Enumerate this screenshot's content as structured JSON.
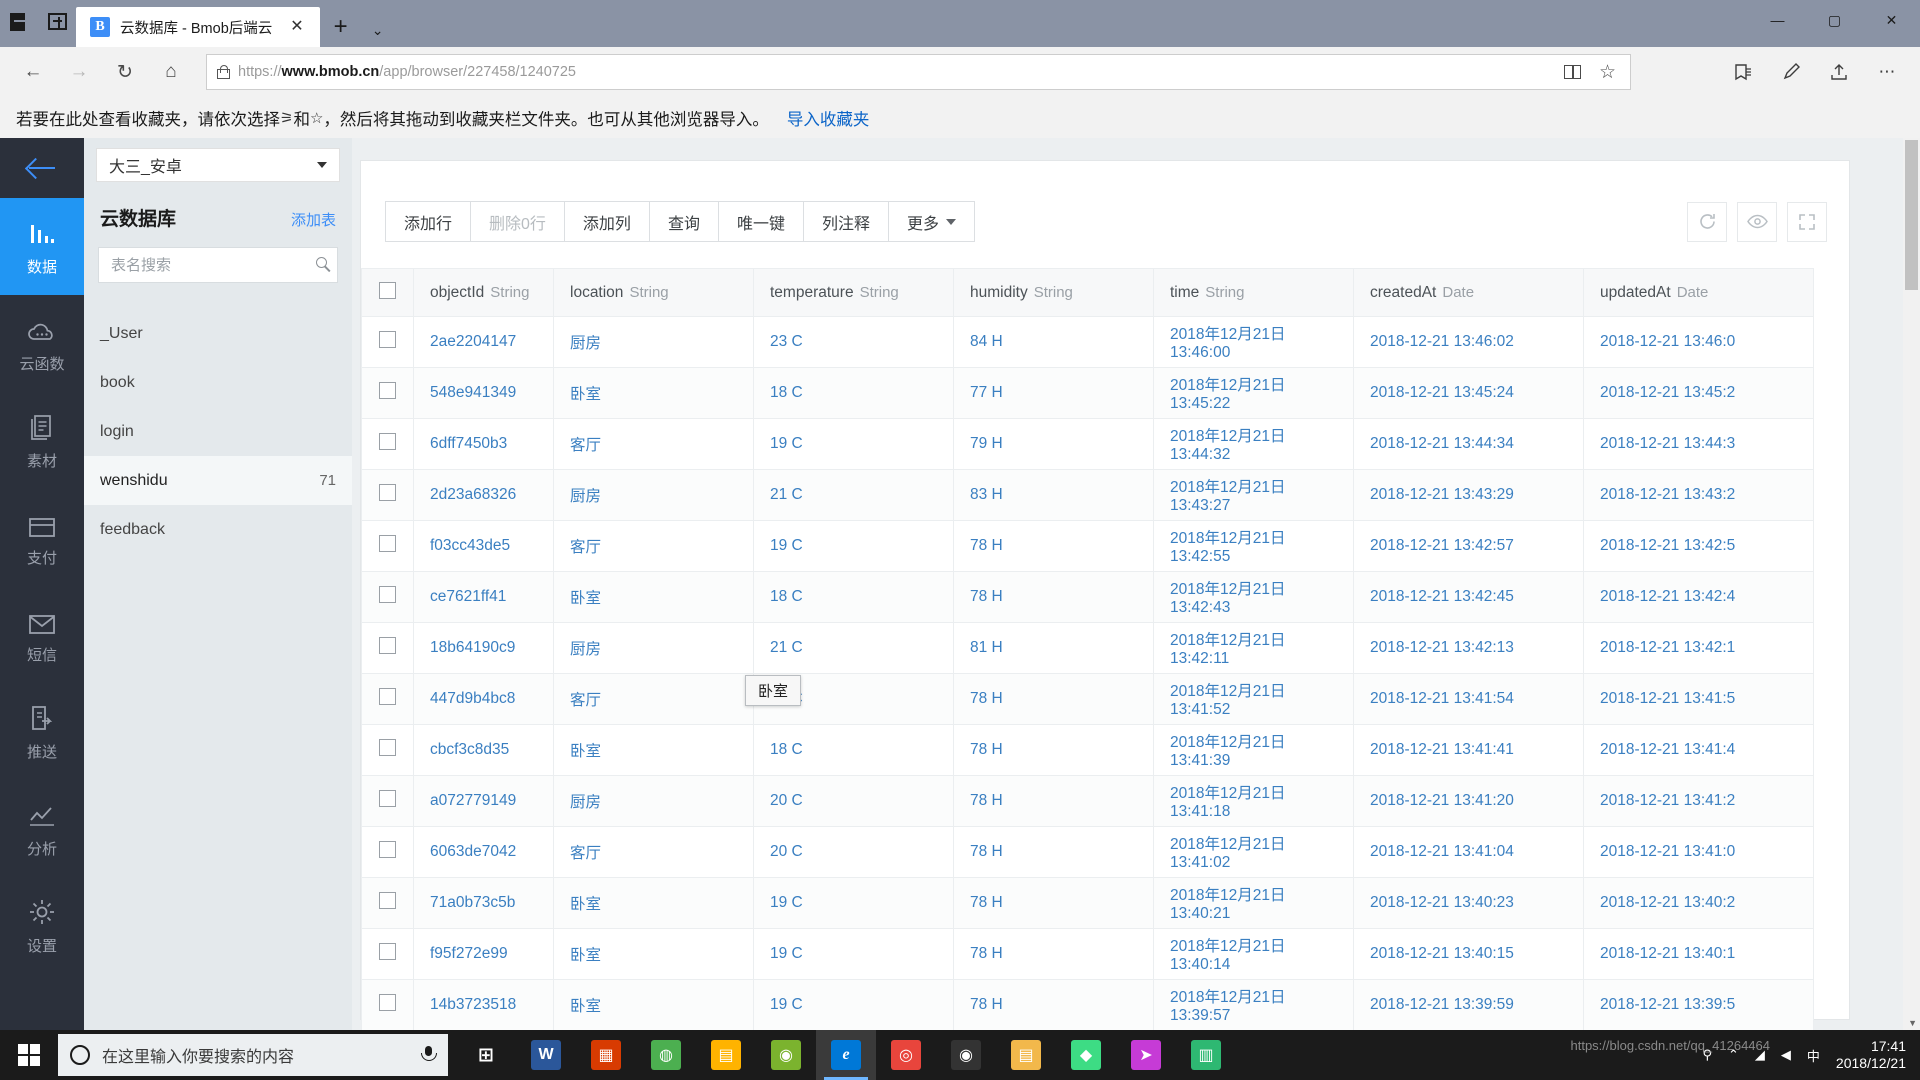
{
  "browser": {
    "tab_title": "云数据库 - Bmob后端云",
    "tab_favicon_letter": "B",
    "tab_close": "✕",
    "new_tab": "+",
    "tab_menu": "⌄",
    "url_scheme": "https://",
    "url_domain": "www.bmob.cn",
    "url_path": "/app/browser/227458/1240725",
    "back": "←",
    "forward": "→",
    "refresh": "↻",
    "home": "⌂",
    "star": "☆",
    "win_minimize": "—",
    "win_maximize": "▢",
    "win_close": "✕",
    "bookmark_bar_text_1": "若要在此处查看收藏夹，请依次选择 ",
    "bookmark_bar_icon_1": "⚞",
    "bookmark_bar_text_2": " 和 ",
    "bookmark_bar_icon_2": "☆",
    "bookmark_bar_text_3": "，然后将其拖动到收藏夹栏文件夹。也可从其他浏览器导入。",
    "bookmark_bar_link": "导入收藏夹"
  },
  "rail": {
    "back_label": "返回",
    "items": [
      {
        "label": "数据",
        "icon": "chart-bars-icon",
        "active": true
      },
      {
        "label": "云函数",
        "icon": "cloud-icon",
        "active": false
      },
      {
        "label": "素材",
        "icon": "documents-icon",
        "active": false
      },
      {
        "label": "支付",
        "icon": "card-icon",
        "active": false
      },
      {
        "label": "短信",
        "icon": "envelope-icon",
        "active": false
      },
      {
        "label": "推送",
        "icon": "push-icon",
        "active": false
      },
      {
        "label": "分析",
        "icon": "analytics-icon",
        "active": false
      },
      {
        "label": "设置",
        "icon": "gear-icon",
        "active": false
      }
    ]
  },
  "sidebar": {
    "project_name": "大三_安卓",
    "section_title": "云数据库",
    "add_table_label": "添加表",
    "search_placeholder": "表名搜索",
    "tables": [
      {
        "name": "_User",
        "count": "",
        "active": false
      },
      {
        "name": "book",
        "count": "",
        "active": false
      },
      {
        "name": "login",
        "count": "",
        "active": false
      },
      {
        "name": "wenshidu",
        "count": "71",
        "active": true
      },
      {
        "name": "feedback",
        "count": "",
        "active": false
      }
    ]
  },
  "toolbar": {
    "buttons": [
      {
        "label": "添加行",
        "disabled": false
      },
      {
        "label": "删除0行",
        "disabled": true
      },
      {
        "label": "添加列",
        "disabled": false
      },
      {
        "label": "查询",
        "disabled": false
      },
      {
        "label": "唯一键",
        "disabled": false
      },
      {
        "label": "列注释",
        "disabled": false
      },
      {
        "label": "更多",
        "disabled": false,
        "dropdown": true
      }
    ],
    "refresh_icon": "refresh-icon",
    "eye_icon": "eye-icon",
    "expand_icon": "fullscreen-icon"
  },
  "tooltip": {
    "text": "卧室"
  },
  "table": {
    "columns": [
      {
        "name": "objectId",
        "type": "String"
      },
      {
        "name": "location",
        "type": "String"
      },
      {
        "name": "temperature",
        "type": "String"
      },
      {
        "name": "humidity",
        "type": "String"
      },
      {
        "name": "time",
        "type": "String"
      },
      {
        "name": "createdAt",
        "type": "Date"
      },
      {
        "name": "updatedAt",
        "type": "Date"
      }
    ],
    "rows": [
      {
        "objectId": "2ae2204147",
        "location": "厨房",
        "temperature": "23 C",
        "humidity": "84 H",
        "time": "2018年12月21日 13:46:00",
        "createdAt": "2018-12-21 13:46:02",
        "updatedAt": "2018-12-21 13:46:0"
      },
      {
        "objectId": "548e941349",
        "location": "卧室",
        "temperature": "18 C",
        "humidity": "77 H",
        "time": "2018年12月21日 13:45:22",
        "createdAt": "2018-12-21 13:45:24",
        "updatedAt": "2018-12-21 13:45:2"
      },
      {
        "objectId": "6dff7450b3",
        "location": "客厅",
        "temperature": "19 C",
        "humidity": "79 H",
        "time": "2018年12月21日 13:44:32",
        "createdAt": "2018-12-21 13:44:34",
        "updatedAt": "2018-12-21 13:44:3"
      },
      {
        "objectId": "2d23a68326",
        "location": "厨房",
        "temperature": "21 C",
        "humidity": "83 H",
        "time": "2018年12月21日 13:43:27",
        "createdAt": "2018-12-21 13:43:29",
        "updatedAt": "2018-12-21 13:43:2"
      },
      {
        "objectId": "f03cc43de5",
        "location": "客厅",
        "temperature": "19 C",
        "humidity": "78 H",
        "time": "2018年12月21日 13:42:55",
        "createdAt": "2018-12-21 13:42:57",
        "updatedAt": "2018-12-21 13:42:5"
      },
      {
        "objectId": "ce7621ff41",
        "location": "卧室",
        "temperature": "18 C",
        "humidity": "78 H",
        "time": "2018年12月21日 13:42:43",
        "createdAt": "2018-12-21 13:42:45",
        "updatedAt": "2018-12-21 13:42:4"
      },
      {
        "objectId": "18b64190c9",
        "location": "厨房",
        "temperature": "21 C",
        "humidity": "81 H",
        "time": "2018年12月21日 13:42:11",
        "createdAt": "2018-12-21 13:42:13",
        "updatedAt": "2018-12-21 13:42:1"
      },
      {
        "objectId": "447d9b4bc8",
        "location": "客厅",
        "temperature": "19 C",
        "humidity": "78 H",
        "time": "2018年12月21日 13:41:52",
        "createdAt": "2018-12-21 13:41:54",
        "updatedAt": "2018-12-21 13:41:5"
      },
      {
        "objectId": "cbcf3c8d35",
        "location": "卧室",
        "temperature": "18 C",
        "humidity": "78 H",
        "time": "2018年12月21日 13:41:39",
        "createdAt": "2018-12-21 13:41:41",
        "updatedAt": "2018-12-21 13:41:4"
      },
      {
        "objectId": "a072779149",
        "location": "厨房",
        "temperature": "20 C",
        "humidity": "78 H",
        "time": "2018年12月21日 13:41:18",
        "createdAt": "2018-12-21 13:41:20",
        "updatedAt": "2018-12-21 13:41:2"
      },
      {
        "objectId": "6063de7042",
        "location": "客厅",
        "temperature": "20 C",
        "humidity": "78 H",
        "time": "2018年12月21日 13:41:02",
        "createdAt": "2018-12-21 13:41:04",
        "updatedAt": "2018-12-21 13:41:0"
      },
      {
        "objectId": "71a0b73c5b",
        "location": "卧室",
        "temperature": "19 C",
        "humidity": "78 H",
        "time": "2018年12月21日 13:40:21",
        "createdAt": "2018-12-21 13:40:23",
        "updatedAt": "2018-12-21 13:40:2"
      },
      {
        "objectId": "f95f272e99",
        "location": "卧室",
        "temperature": "19 C",
        "humidity": "78 H",
        "time": "2018年12月21日 13:40:14",
        "createdAt": "2018-12-21 13:40:15",
        "updatedAt": "2018-12-21 13:40:1"
      },
      {
        "objectId": "14b3723518",
        "location": "卧室",
        "temperature": "19 C",
        "humidity": "78 H",
        "time": "2018年12月21日 13:39:57",
        "createdAt": "2018-12-21 13:39:59",
        "updatedAt": "2018-12-21 13:39:5"
      }
    ]
  },
  "taskbar": {
    "search_placeholder": "在这里输入你要搜索的内容",
    "clock_time": "17:41",
    "clock_date": "2018/12/21",
    "apps": [
      {
        "name": "task-view",
        "glyph": "⊞",
        "color": "#1b1b1b",
        "active": false
      },
      {
        "name": "word",
        "glyph": "W",
        "color": "#2b579a",
        "active": false
      },
      {
        "name": "store",
        "glyph": "▦",
        "color": "#d83b01",
        "active": false
      },
      {
        "name": "browser-globe",
        "glyph": "◍",
        "color": "#4caf50",
        "active": false
      },
      {
        "name": "file-explorer",
        "glyph": "▤",
        "color": "#ffb300",
        "active": false
      },
      {
        "name": "wechat",
        "glyph": "◉",
        "color": "#7bb32e",
        "active": false
      },
      {
        "name": "edge",
        "glyph": "e",
        "color": "#0078d7",
        "active": true
      },
      {
        "name": "chrome",
        "glyph": "◎",
        "color": "#e8453c",
        "active": false
      },
      {
        "name": "cd-player",
        "glyph": "◉",
        "color": "#333333",
        "active": false
      },
      {
        "name": "folder",
        "glyph": "▤",
        "color": "#f2b84b",
        "active": false
      },
      {
        "name": "android-studio",
        "glyph": "◆",
        "color": "#3ddc84",
        "active": false
      },
      {
        "name": "rocket",
        "glyph": "➤",
        "color": "#c63bd6",
        "active": false
      },
      {
        "name": "calendar",
        "glyph": "▥",
        "color": "#2eb872",
        "active": false
      }
    ],
    "tray_pin": "⚲",
    "tray_chevron": "⌃",
    "tray_network": "◢",
    "tray_volume": "◀",
    "tray_ime": "中"
  },
  "watermark": "https://blog.csdn.net/qq_41264464"
}
